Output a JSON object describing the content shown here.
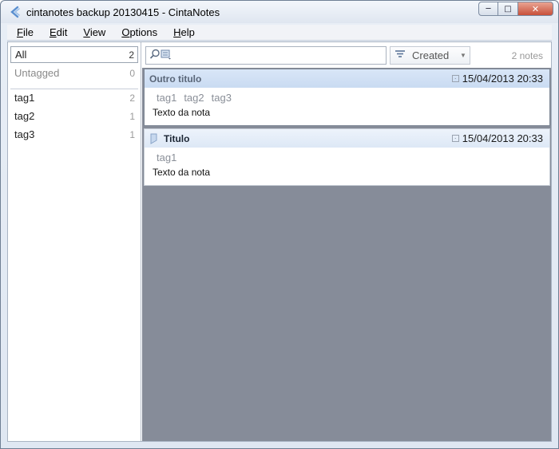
{
  "window": {
    "title": "cintanotes backup 20130415 - CintaNotes",
    "controls": {
      "minimize": "minimize",
      "maximize": "maximize",
      "close": "close"
    }
  },
  "menu": [
    {
      "label": "File",
      "underline": "F",
      "rest": "ile"
    },
    {
      "label": "Edit",
      "underline": "E",
      "rest": "dit"
    },
    {
      "label": "View",
      "underline": "V",
      "rest": "iew"
    },
    {
      "label": "Options",
      "underline": "O",
      "rest": "ptions"
    },
    {
      "label": "Help",
      "underline": "H",
      "rest": "elp"
    }
  ],
  "sidebar": {
    "items": [
      {
        "label": "All",
        "count": "2",
        "selected": true
      },
      {
        "label": "Untagged",
        "count": "0"
      },
      {
        "label": "tag1",
        "count": "2"
      },
      {
        "label": "tag2",
        "count": "1"
      },
      {
        "label": "tag3",
        "count": "1"
      }
    ]
  },
  "toolbar": {
    "search_value": "",
    "sort_label": "Created",
    "notes_count": "2 notes"
  },
  "notes": [
    {
      "title": "Outro titulo",
      "date": "15/04/2013 20:33",
      "tags": [
        "tag1",
        "tag2",
        "tag3"
      ],
      "body": "Texto da nota"
    },
    {
      "title": "Titulo",
      "date": "15/04/2013 20:33",
      "tags": [
        "tag1"
      ],
      "body": "Texto da nota"
    }
  ],
  "colors": {
    "accent": "#c9dbf2",
    "content_background": "#868c99"
  }
}
